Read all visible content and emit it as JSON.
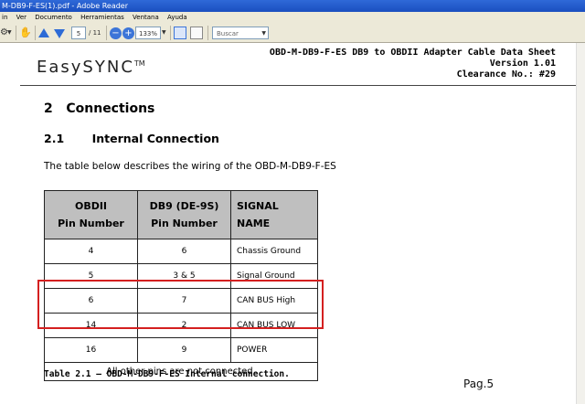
{
  "window": {
    "title": "M-DB9-F-ES(1).pdf - Adobe Reader"
  },
  "menubar": {
    "items": [
      "in",
      "Ver",
      "Documento",
      "Herramientas",
      "Ventana",
      "Ayuda"
    ]
  },
  "toolbar": {
    "page_current": "5",
    "page_total": "/ 11",
    "zoom": "133%",
    "search_placeholder": "Buscar"
  },
  "document": {
    "logo": "EasySYNC",
    "logo_mark": "TM",
    "header": {
      "line1": "OBD-M-DB9-F-ES DB9 to OBDII Adapter Cable Data Sheet",
      "line2": "Version 1.01",
      "line3": "Clearance No.: #29"
    },
    "section_title": "2   Connections",
    "subsection_title": "2.1       Internal Connection",
    "paragraph": "The table below describes the wiring of the OBD-M-DB9-F-ES",
    "table": {
      "headers": [
        {
          "line1": "OBDII",
          "line2": "Pin Number"
        },
        {
          "line1": "DB9 (DE-9S)",
          "line2": "Pin Number"
        },
        {
          "line1": "SIGNAL",
          "line2": "NAME"
        }
      ],
      "rows": [
        {
          "obd": "4",
          "db9": "6",
          "signal": "Chassis Ground"
        },
        {
          "obd": "5",
          "db9": "3 & 5",
          "signal": "Signal Ground"
        },
        {
          "obd": "6",
          "db9": "7",
          "signal": "CAN BUS High"
        },
        {
          "obd": "14",
          "db9": "2",
          "signal": "CAN BUS LOW"
        },
        {
          "obd": "16",
          "db9": "9",
          "signal": "POWER"
        }
      ],
      "note": "All other pins are not connected."
    },
    "caption": "Table 2.1 – OBD-M-DB9-F-ES Internal connection.",
    "page_label": "Pag.5"
  },
  "colors": {
    "highlight": "#d42020",
    "table_header_bg": "#bfbfbf"
  }
}
